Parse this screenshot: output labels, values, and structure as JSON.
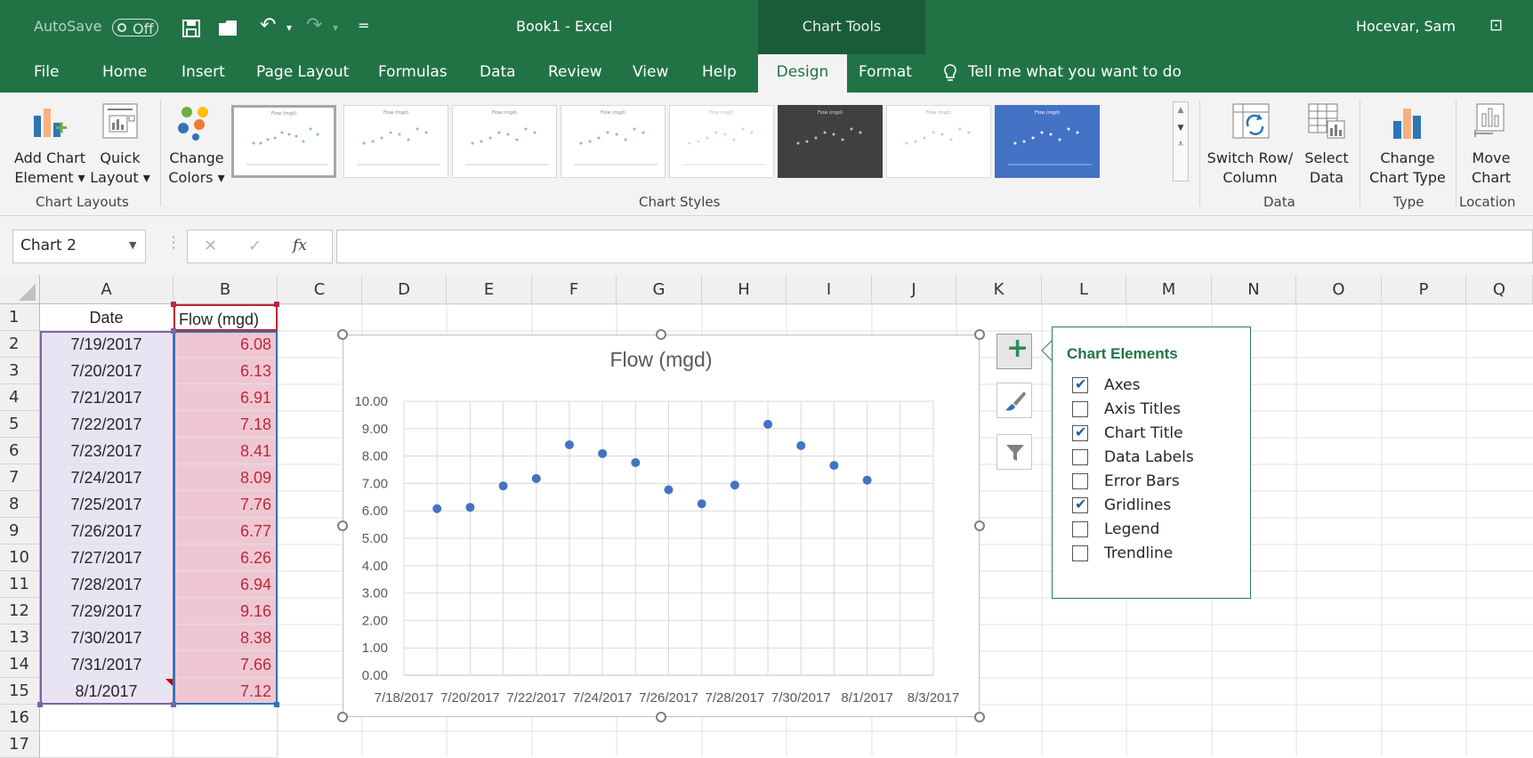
{
  "titlebar": {
    "autosave_label": "AutoSave",
    "autosave_state": "Off",
    "undo_glyph": "↶",
    "redo_glyph": "↷",
    "customize_glyph": "=",
    "book_title": "Book1  -  Excel",
    "context_title": "Chart Tools",
    "user": "Hocevar, Sam",
    "ribbon_display_glyph": "⊡",
    "accent_color": "#217346"
  },
  "tabs": [
    {
      "id": "file",
      "label": "File"
    },
    {
      "id": "home",
      "label": "Home"
    },
    {
      "id": "insert",
      "label": "Insert"
    },
    {
      "id": "page-layout",
      "label": "Page Layout"
    },
    {
      "id": "formulas",
      "label": "Formulas"
    },
    {
      "id": "data",
      "label": "Data"
    },
    {
      "id": "review",
      "label": "Review"
    },
    {
      "id": "view",
      "label": "View"
    },
    {
      "id": "help",
      "label": "Help"
    },
    {
      "id": "design",
      "label": "Design",
      "active": true
    },
    {
      "id": "format",
      "label": "Format"
    }
  ],
  "tell_me": "Tell me what you want to do",
  "ribbon": {
    "add_chart_element": {
      "line1": "Add Chart",
      "line2": "Element ▾"
    },
    "quick_layout": {
      "line1": "Quick",
      "line2": "Layout ▾"
    },
    "change_colors": {
      "line1": "Change",
      "line2": "Colors ▾"
    },
    "switch_row_col": {
      "line1": "Switch Row/",
      "line2": "Column"
    },
    "select_data": {
      "line1": "Select",
      "line2": "Data"
    },
    "change_chart_type": {
      "line1": "Change",
      "line2": "Chart Type"
    },
    "move_chart": {
      "line1": "Move",
      "line2": "Chart"
    },
    "groups": {
      "chart_layouts": "Chart Layouts",
      "chart_styles": "Chart Styles",
      "data": "Data",
      "type": "Type",
      "location": "Location"
    },
    "chart_styles": [
      {
        "style": "plain",
        "selected": true
      },
      {
        "style": "plain"
      },
      {
        "style": "plain"
      },
      {
        "style": "light-gray"
      },
      {
        "style": "faint"
      },
      {
        "style": "dark",
        "bg": "#404040"
      },
      {
        "style": "faint"
      },
      {
        "style": "blue",
        "bg": "#4472c4"
      }
    ]
  },
  "formula_bar": {
    "name_box": "Chart 2",
    "cancel_glyph": "✕",
    "enter_glyph": "✓",
    "fx_label": "fx",
    "formula": ""
  },
  "sheet": {
    "columns": [
      "A",
      "B",
      "C",
      "D",
      "E",
      "F",
      "G",
      "H",
      "I",
      "J",
      "K",
      "L",
      "M",
      "N",
      "O",
      "P",
      "Q"
    ],
    "rows": [
      "1",
      "2",
      "3",
      "4",
      "5",
      "6",
      "7",
      "8",
      "9",
      "10",
      "11",
      "12",
      "13",
      "14",
      "15",
      "16",
      "17"
    ],
    "headers": {
      "a1": "Date",
      "b1": "Flow (mgd)"
    },
    "data": [
      {
        "date": "7/19/2017",
        "flow": "6.08"
      },
      {
        "date": "7/20/2017",
        "flow": "6.13"
      },
      {
        "date": "7/21/2017",
        "flow": "6.91"
      },
      {
        "date": "7/22/2017",
        "flow": "7.18"
      },
      {
        "date": "7/23/2017",
        "flow": "8.41"
      },
      {
        "date": "7/24/2017",
        "flow": "8.09"
      },
      {
        "date": "7/25/2017",
        "flow": "7.76"
      },
      {
        "date": "7/26/2017",
        "flow": "6.77"
      },
      {
        "date": "7/27/2017",
        "flow": "6.26"
      },
      {
        "date": "7/28/2017",
        "flow": "6.94"
      },
      {
        "date": "7/29/2017",
        "flow": "9.16"
      },
      {
        "date": "7/30/2017",
        "flow": "8.38"
      },
      {
        "date": "7/31/2017",
        "flow": "7.66"
      },
      {
        "date": "8/1/2017",
        "flow": "7.12"
      }
    ]
  },
  "chart_data": {
    "type": "scatter",
    "title": "Flow (mgd)",
    "x": [
      "7/19/2017",
      "7/20/2017",
      "7/21/2017",
      "7/22/2017",
      "7/23/2017",
      "7/24/2017",
      "7/25/2017",
      "7/26/2017",
      "7/27/2017",
      "7/28/2017",
      "7/29/2017",
      "7/30/2017",
      "7/31/2017",
      "8/1/2017"
    ],
    "y": [
      6.08,
      6.13,
      6.91,
      7.18,
      8.41,
      8.09,
      7.76,
      6.77,
      6.26,
      6.94,
      9.16,
      8.38,
      7.66,
      7.12
    ],
    "xlim": [
      "7/18/2017",
      "8/3/2017"
    ],
    "ylim": [
      0,
      10
    ],
    "x_tick_labels": [
      "7/18/2017",
      "7/20/2017",
      "7/22/2017",
      "7/24/2017",
      "7/26/2017",
      "7/28/2017",
      "7/30/2017",
      "8/1/2017",
      "8/3/2017"
    ],
    "y_tick_labels": [
      "0.00",
      "1.00",
      "2.00",
      "3.00",
      "4.00",
      "5.00",
      "6.00",
      "7.00",
      "8.00",
      "9.00",
      "10.00"
    ],
    "grid": true,
    "legend": false,
    "marker_color": "#4472c4"
  },
  "chart_side_buttons": {
    "elements_glyph": "+",
    "styles_icon": "paintbrush",
    "filters_icon": "funnel"
  },
  "chart_elements_panel": {
    "title": "Chart Elements",
    "items": [
      {
        "label": "Axes",
        "checked": true
      },
      {
        "label": "Axis Titles",
        "checked": false
      },
      {
        "label": "Chart Title",
        "checked": true
      },
      {
        "label": "Data Labels",
        "checked": false
      },
      {
        "label": "Error Bars",
        "checked": false
      },
      {
        "label": "Gridlines",
        "checked": true
      },
      {
        "label": "Legend",
        "checked": false
      },
      {
        "label": "Trendline",
        "checked": false
      }
    ],
    "check_glyph": "✔"
  }
}
